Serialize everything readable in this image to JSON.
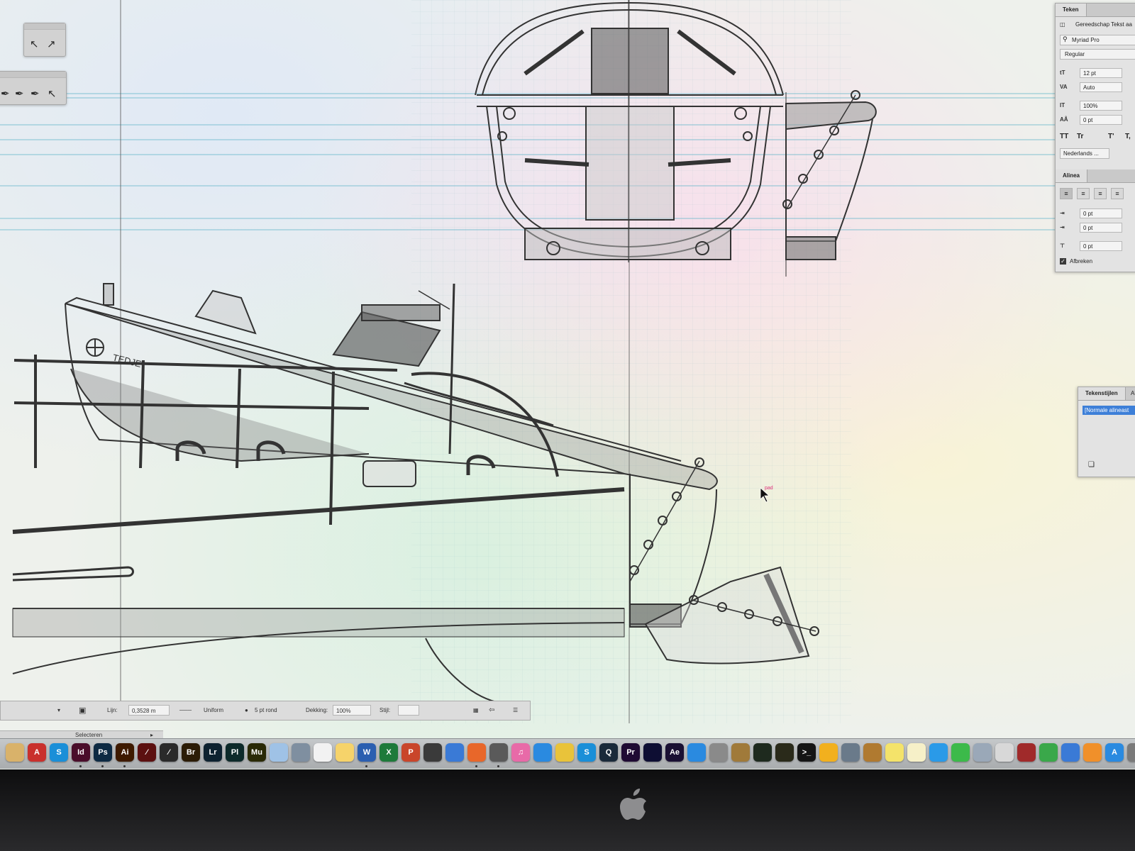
{
  "drawing": {
    "hull_lettering": "TEDJE"
  },
  "character_panel": {
    "tab": "Teken",
    "tool_label": "Gereedschap Tekst aa",
    "font_family": "Myriad Pro",
    "font_style": "Regular",
    "font_size": "12 pt",
    "leading": "Auto",
    "vertical_scale": "100%",
    "baseline_shift": "0 pt",
    "caps_buttons": [
      "TT",
      "Tr",
      "T'",
      "T,"
    ],
    "language": "Nederlands ..."
  },
  "paragraph_panel": {
    "tab": "Alinea",
    "left_indent": "0 pt",
    "first_line_indent": "0 pt",
    "space_before": "0 pt",
    "hyphenate_label": "Afbreken",
    "hyphenate_checked": true
  },
  "styles_panel": {
    "tab": "Tekenstijlen",
    "tab2": "Al",
    "selected_style": "[Normale alineast"
  },
  "control_bar": {
    "line_label": "Lijn:",
    "stroke_weight": "0,3528 m",
    "profile": "Uniform",
    "brush": "5 pt rond",
    "opacity_label": "Dekking:",
    "opacity": "100%",
    "style_label": "Stijl:"
  },
  "status_bar": {
    "text": "Selecteren"
  },
  "cursor_label": "pad",
  "dock": {
    "apps": [
      {
        "name": "finder-icon",
        "label": "",
        "color": "#d9b26a"
      },
      {
        "name": "acrobat-icon",
        "label": "A",
        "color": "#c9302c"
      },
      {
        "name": "skype-icon",
        "label": "S",
        "color": "#1a8fd8"
      },
      {
        "name": "indesign-icon",
        "label": "Id",
        "color": "#4a0d2a"
      },
      {
        "name": "photoshop-icon",
        "label": "Ps",
        "color": "#0d2a43"
      },
      {
        "name": "illustrator-icon",
        "label": "Ai",
        "color": "#3e1a00"
      },
      {
        "name": "acrobat-dc-icon",
        "label": "⁄",
        "color": "#5c1010"
      },
      {
        "name": "acrobat-reader-icon",
        "label": "⁄",
        "color": "#2a2a2a"
      },
      {
        "name": "bridge-icon",
        "label": "Br",
        "color": "#2b1c06"
      },
      {
        "name": "lightroom-icon",
        "label": "Lr",
        "color": "#0d2230"
      },
      {
        "name": "prelude-icon",
        "label": "Pl",
        "color": "#0d2a2a"
      },
      {
        "name": "muse-icon",
        "label": "Mu",
        "color": "#2a2a06"
      },
      {
        "name": "folder-icon",
        "label": "",
        "color": "#9fc2e6"
      },
      {
        "name": "preview-icon",
        "label": "",
        "color": "#7f8fa0"
      },
      {
        "name": "textedit-icon",
        "label": "",
        "color": "#f2f2f2"
      },
      {
        "name": "photos-icon",
        "label": "",
        "color": "#f6d36a"
      },
      {
        "name": "word-icon",
        "label": "W",
        "color": "#2b5fb0"
      },
      {
        "name": "excel-icon",
        "label": "X",
        "color": "#1e7a3a"
      },
      {
        "name": "powerpoint-icon",
        "label": "P",
        "color": "#c9452a"
      },
      {
        "name": "safari-dev-icon",
        "label": "",
        "color": "#3a3a3a"
      },
      {
        "name": "mail-icon",
        "label": "",
        "color": "#3a7ad6"
      },
      {
        "name": "firefox-icon",
        "label": "",
        "color": "#e8672a"
      },
      {
        "name": "pro-app-icon",
        "label": "",
        "color": "#5a5a5a"
      },
      {
        "name": "itunes-icon",
        "label": "♫",
        "color": "#e86aa8"
      },
      {
        "name": "safari-icon",
        "label": "",
        "color": "#2a8ae0"
      },
      {
        "name": "chrome-icon",
        "label": "",
        "color": "#e9c33a"
      },
      {
        "name": "skype-2-icon",
        "label": "S",
        "color": "#1a8fd8"
      },
      {
        "name": "quicktime-icon",
        "label": "Q",
        "color": "#1a2a3a"
      },
      {
        "name": "premiere-icon",
        "label": "Pr",
        "color": "#1f0a33"
      },
      {
        "name": "media-encoder-icon",
        "label": "",
        "color": "#0e0e33"
      },
      {
        "name": "after-effects-icon",
        "label": "Ae",
        "color": "#1a1033"
      },
      {
        "name": "lite-app-icon",
        "label": "",
        "color": "#2a8ae0"
      },
      {
        "name": "scanner-icon",
        "label": "",
        "color": "#8a8a8a"
      },
      {
        "name": "utility-icon",
        "label": "",
        "color": "#a07a3a"
      },
      {
        "name": "activity-monitor-icon",
        "label": "",
        "color": "#1e2a1e"
      },
      {
        "name": "console-icon",
        "label": "",
        "color": "#2a2a1a"
      },
      {
        "name": "terminal-icon",
        "label": ">_",
        "color": "#151515"
      },
      {
        "name": "drive-icon",
        "label": "",
        "color": "#f2b01e"
      },
      {
        "name": "disk-utility-icon",
        "label": "",
        "color": "#6a7a8a"
      },
      {
        "name": "notes-brown-icon",
        "label": "",
        "color": "#b07a30"
      },
      {
        "name": "stickies-icon",
        "label": "",
        "color": "#f4e36a"
      },
      {
        "name": "notes-icon",
        "label": "",
        "color": "#f6f0c8"
      },
      {
        "name": "messages-icon",
        "label": "",
        "color": "#2a9ae8"
      },
      {
        "name": "facetime-icon",
        "label": "",
        "color": "#3cba4a"
      },
      {
        "name": "preview-2-icon",
        "label": "",
        "color": "#9aa8b8"
      },
      {
        "name": "script-icon",
        "label": "",
        "color": "#d8d8d8"
      },
      {
        "name": "photo-booth-icon",
        "label": "",
        "color": "#a02a2a"
      },
      {
        "name": "numbers-icon",
        "label": "",
        "color": "#3aa84a"
      },
      {
        "name": "keynote-icon",
        "label": "",
        "color": "#3a7ad6"
      },
      {
        "name": "ibooks-icon",
        "label": "",
        "color": "#f0902a"
      },
      {
        "name": "app-store-icon",
        "label": "A",
        "color": "#2a8ae0"
      },
      {
        "name": "system-prefs-icon",
        "label": "",
        "color": "#7a7a7a"
      }
    ]
  }
}
